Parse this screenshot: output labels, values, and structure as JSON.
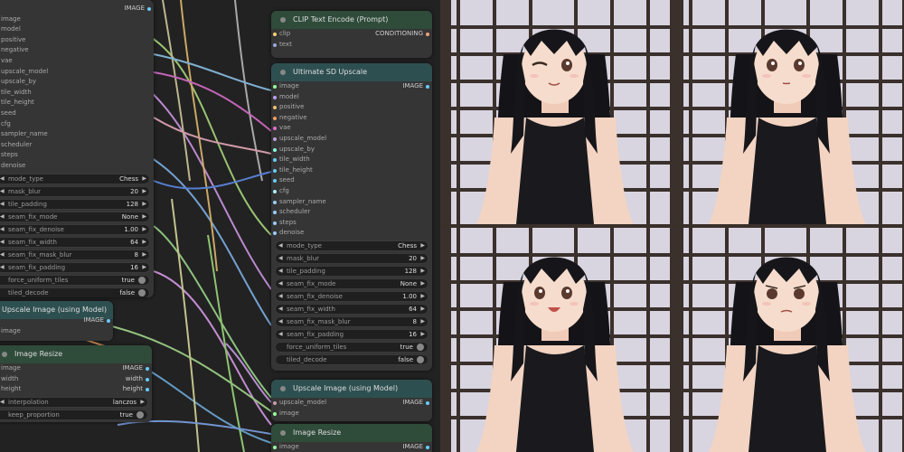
{
  "colors": {
    "node_bg": "#353535",
    "node_head_green": "#2f4b3a",
    "node_head_teal": "#2e4f50",
    "canvas_bg": "#222222"
  },
  "node_left": {
    "output_label": "IMAGE",
    "inputs": [
      "image",
      "model",
      "positive",
      "negative",
      "vae",
      "upscale_model",
      "upscale_by",
      "tile_width",
      "tile_height",
      "seed",
      "cfg",
      "sampler_name",
      "scheduler",
      "steps",
      "denoise"
    ],
    "widgets": [
      {
        "name": "mode_type",
        "value": "Chess"
      },
      {
        "name": "mask_blur",
        "value": "20"
      },
      {
        "name": "tile_padding",
        "value": "128"
      },
      {
        "name": "seam_fix_mode",
        "value": "None"
      },
      {
        "name": "seam_fix_denoise",
        "value": "1.00"
      },
      {
        "name": "seam_fix_width",
        "value": "64"
      },
      {
        "name": "seam_fix_mask_blur",
        "value": "8"
      },
      {
        "name": "seam_fix_padding",
        "value": "16"
      }
    ],
    "toggles": [
      {
        "name": "force_uniform_tiles",
        "value": "true"
      },
      {
        "name": "tiled_decode",
        "value": "false"
      }
    ]
  },
  "node_upscale_left": {
    "title": "Upscale Image (using Model)",
    "output_label": "IMAGE",
    "input": "image"
  },
  "node_resize_left": {
    "title": "Image Resize",
    "inputs": [
      "image",
      "width",
      "height"
    ],
    "outputs": [
      "IMAGE",
      "width",
      "height"
    ],
    "widget": {
      "name": "interpolation",
      "value": "lanczos"
    },
    "toggle": {
      "name": "keep_proportion",
      "value": "true"
    }
  },
  "node_clip": {
    "title": "CLIP Text Encode (Prompt)",
    "inputs": [
      "clip",
      "text"
    ],
    "output_label": "CONDITIONING"
  },
  "node_usd": {
    "title": "Ultimate SD Upscale",
    "output_label": "IMAGE",
    "inputs": [
      "image",
      "model",
      "positive",
      "negative",
      "vae",
      "upscale_model",
      "upscale_by",
      "tile_width",
      "tile_height",
      "seed",
      "cfg",
      "sampler_name",
      "scheduler",
      "steps",
      "denoise"
    ],
    "widgets": [
      {
        "name": "mode_type",
        "value": "Chess"
      },
      {
        "name": "mask_blur",
        "value": "20"
      },
      {
        "name": "tile_padding",
        "value": "128"
      },
      {
        "name": "seam_fix_mode",
        "value": "None"
      },
      {
        "name": "seam_fix_denoise",
        "value": "1.00"
      },
      {
        "name": "seam_fix_width",
        "value": "64"
      },
      {
        "name": "seam_fix_mask_blur",
        "value": "8"
      },
      {
        "name": "seam_fix_padding",
        "value": "16"
      }
    ],
    "toggles": [
      {
        "name": "force_uniform_tiles",
        "value": "true"
      },
      {
        "name": "tiled_decode",
        "value": "false"
      }
    ]
  },
  "node_upscale_right": {
    "title": "Upscale Image (using Model)",
    "inputs": [
      "upscale_model",
      "image"
    ],
    "output_label": "IMAGE"
  },
  "node_resize_right": {
    "title": "Image Resize",
    "input": "image",
    "output_label": "IMAGE"
  },
  "preview": {
    "panels": [
      "wink",
      "neutral",
      "smile",
      "frown"
    ]
  }
}
